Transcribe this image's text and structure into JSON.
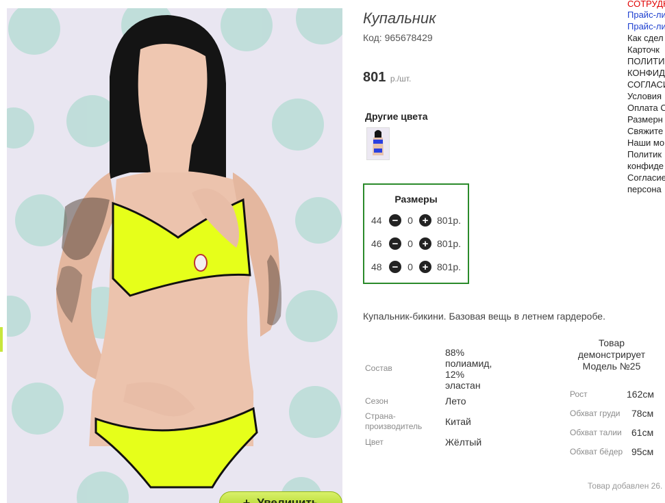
{
  "product": {
    "title": "Купальник",
    "code": "Код: 965678429",
    "price_value": "801",
    "price_unit": "р./шт.",
    "other_colors_label": "Другие цвета",
    "zoom_label": "Увеличить",
    "description": "Купальник-бикини. Базовая вещь в летнем гардеробе.",
    "added": "Товар добавлен 26."
  },
  "sizes": {
    "title": "Размеры",
    "rows": [
      {
        "size": "44",
        "qty": "0",
        "price": "801р."
      },
      {
        "size": "46",
        "qty": "0",
        "price": "801р."
      },
      {
        "size": "48",
        "qty": "0",
        "price": "801р."
      }
    ]
  },
  "specs": {
    "composition_label": "Состав",
    "composition_lines": [
      "88%",
      "полиамид,",
      "12%",
      "эластан"
    ],
    "season_label": "Сезон",
    "season": "Лето",
    "country_label_1": "Страна-",
    "country_label_2": "производитель",
    "country": "Китай",
    "color_label": "Цвет",
    "color": "Жёлтый"
  },
  "model": {
    "title_lines": [
      "Товар",
      "демонстрирует",
      "Модель №25"
    ],
    "height_label": "Рост",
    "height": "162см",
    "chest_label": "Обхват груди",
    "chest": "78см",
    "waist_label": "Обхват талии",
    "waist": "61см",
    "hips_label": "Обхват бёдер",
    "hips": "95см"
  },
  "nav": {
    "items": [
      "СОТРУДН",
      "Прайс-ли",
      "Прайс-ли",
      "Как сдел",
      "Карточк",
      "ПОЛИТИ",
      "КОНФИД",
      "СОГЛАСИ",
      "Условия",
      "Оплата С",
      "Размерн",
      "Свяжите",
      "Наши мо",
      "Политик",
      "конфиде",
      "Согласие",
      "персона"
    ]
  },
  "colors": {
    "accent_green": "#2a8a2a",
    "link_blue": "#1d3fd0",
    "alert_red": "#e00000",
    "swimsuit_yellow": "#e6ff1a"
  }
}
